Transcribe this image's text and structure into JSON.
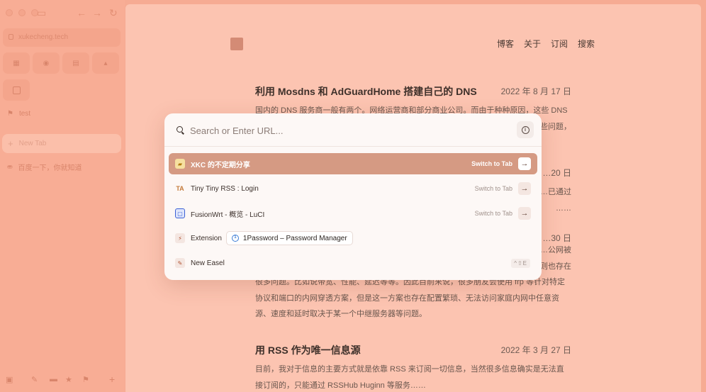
{
  "sidebar": {
    "url": "xukecheng.tech",
    "folder_label": "test",
    "new_tab_label": "New Tab",
    "tab_title": "百度一下，你就知道"
  },
  "blog": {
    "nav": [
      "博客",
      "关于",
      "订阅",
      "搜索"
    ],
    "posts": [
      {
        "title": "利用 Mosdns 和 AdGuardHome 搭建自己的 DNS",
        "date": "2022 年 8 月 17 日",
        "excerpt_lines": [
          "国内的 DNS 服务商一般有两个。网络运营商和部分商业公司。而由于种种原因，这些 DNS",
          "…些问题，"
        ]
      },
      {
        "title": "",
        "date": "…20 日",
        "excerpt_lines": [
          "…已通过",
          "……"
        ]
      },
      {
        "title": "",
        "date": "…30 日",
        "excerpt_lines": [
          "…公网被",
          "…则也存在",
          "很多问题。比如说带宽、性能、延迟等等。因此目前来说，很多朋友会使用 frp 等针对特定",
          "协议和端口的内网穿透方案，但是这一方案也存在配置繁琐、无法访问家庭内网中任意资",
          "源、速度和延时取决于某一个中继服务器等问题。"
        ]
      },
      {
        "title": "用 RSS 作为唯一信息源",
        "date": "2022 年 3 月 27 日",
        "excerpt_lines": [
          "目前，我对于信息的主要方式就是依靠 RSS 来订阅一切信息，当然很多信息确实是无法直",
          "接订阅的，只能通过 RSSHub Huginn 等服务……"
        ]
      }
    ]
  },
  "palette": {
    "search_placeholder": "Search or Enter URL...",
    "results": [
      {
        "title": "XKC 的不定期分享",
        "action": "Switch to Tab",
        "selected": true
      },
      {
        "title": "Tiny Tiny RSS : Login",
        "action": "Switch to Tab",
        "selected": false
      },
      {
        "title": "FusionWrt - 概览 - LuCI",
        "action": "Switch to Tab",
        "selected": false
      }
    ],
    "extension": {
      "label": "Extension",
      "name": "1Password – Password Manager"
    },
    "new_easel": {
      "label": "New Easel",
      "shortcut": "^⇧E"
    }
  },
  "colors": {
    "page_bg": "#fcc4b1",
    "sidebar_bg": "#f8ad95",
    "palette_bg": "#fdf8f6",
    "selected_row": "#d59a83"
  }
}
